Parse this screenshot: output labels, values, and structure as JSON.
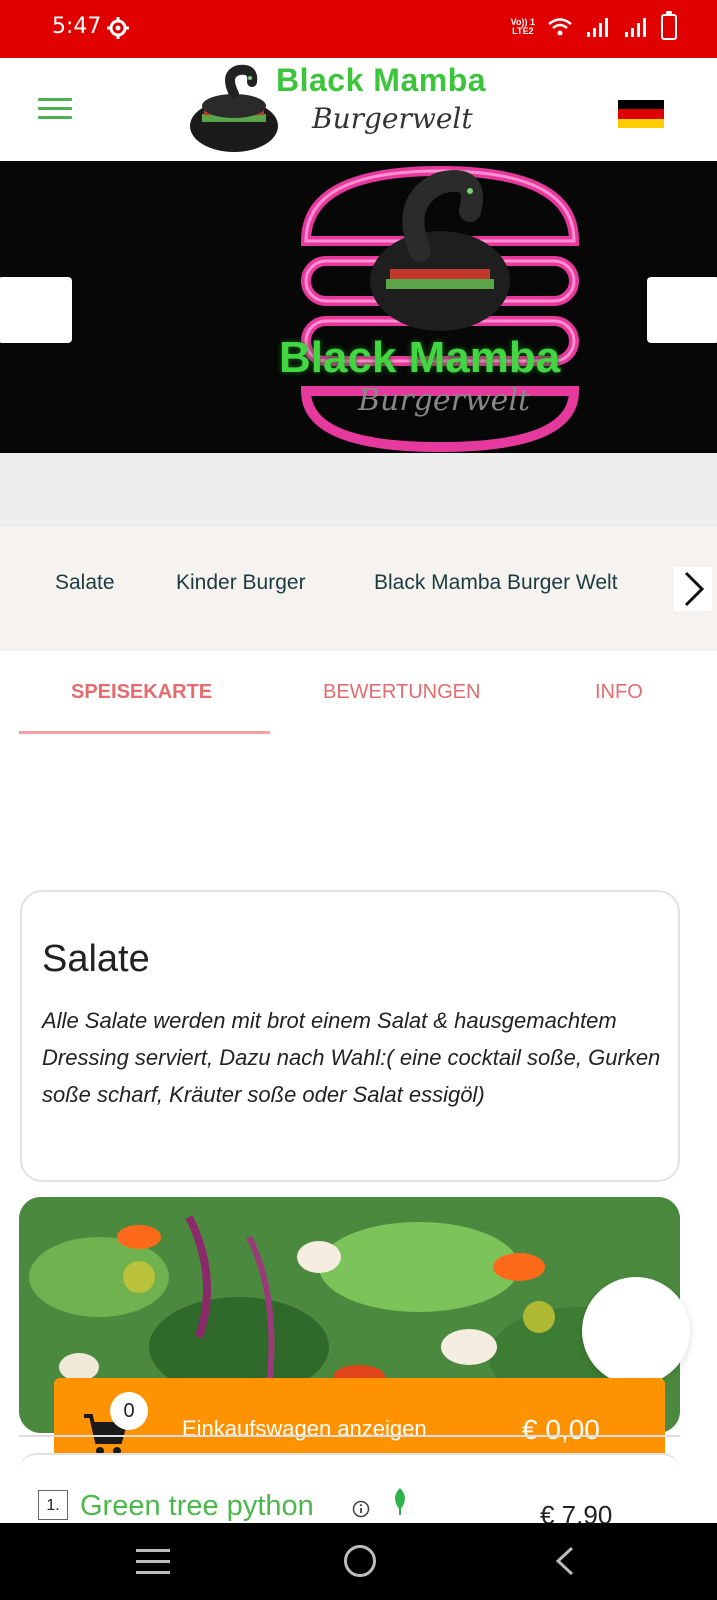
{
  "status_bar": {
    "time": "5:47",
    "volte_line1": "Vo)) 1",
    "volte_line2": "LTE2"
  },
  "header": {
    "brand_title": "Black Mamba",
    "brand_subtitle": "Burgerwelt",
    "language_flag": "germany-flag"
  },
  "hero": {
    "title": "Black Mamba",
    "subtitle": "Burgerwelt"
  },
  "categories": {
    "items": [
      "Salate",
      "Kinder Burger",
      "Black Mamba Burger Welt"
    ]
  },
  "tabs": {
    "items": [
      "SPEISEKARTE",
      "BEWERTUNGEN",
      "INFO"
    ],
    "active": "SPEISEKARTE"
  },
  "category_section": {
    "title": "Salate",
    "description": "Alle Salate werden mit brot einem Salat & hausgemachtem Dressing serviert, Dazu nach Wahl:( eine cocktail soße, Gurken soße scharf, Kräuter soße oder Salat essigöl)"
  },
  "cart": {
    "count": "0",
    "label": "Einkaufswagen anzeigen",
    "total": "€ 0,00"
  },
  "item": {
    "number": "1.",
    "name": "Green tree python",
    "price": "€ 7,90"
  },
  "colors": {
    "status_bar": "#e00000",
    "brand_green": "#3cc43c",
    "tab_accent": "#e56b6f",
    "cart_orange": "#ff9200"
  }
}
